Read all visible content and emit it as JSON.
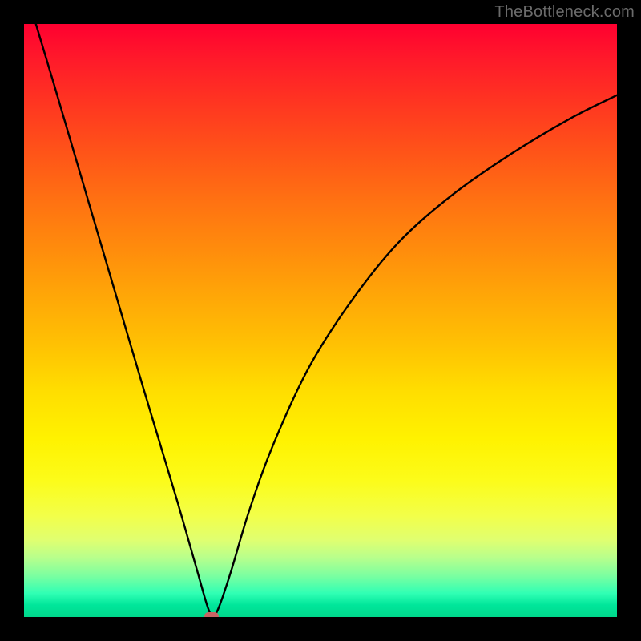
{
  "watermark": {
    "text": "TheBottleneck.com"
  },
  "chart_data": {
    "type": "line",
    "title": "",
    "xlabel": "",
    "ylabel": "",
    "xlim": [
      0,
      100
    ],
    "ylim": [
      0,
      100
    ],
    "series": [
      {
        "name": "bottleneck-curve",
        "x": [
          2,
          5,
          10,
          15,
          20,
          23,
          26,
          29,
          30.8,
          31.6,
          32,
          33,
          35,
          38,
          42,
          48,
          55,
          63,
          72,
          82,
          92,
          100
        ],
        "y": [
          100,
          90,
          73,
          56,
          39,
          29,
          19,
          8.5,
          2.2,
          0.2,
          0,
          2,
          8,
          18,
          29,
          42,
          53,
          63,
          71,
          78,
          84,
          88
        ]
      }
    ],
    "marker": {
      "name": "optimum-point",
      "x": 31.6,
      "y": 0.2
    },
    "background_gradient": {
      "top": "#ff0030",
      "mid": "#ffde00",
      "bottom": "#00d88c"
    }
  }
}
